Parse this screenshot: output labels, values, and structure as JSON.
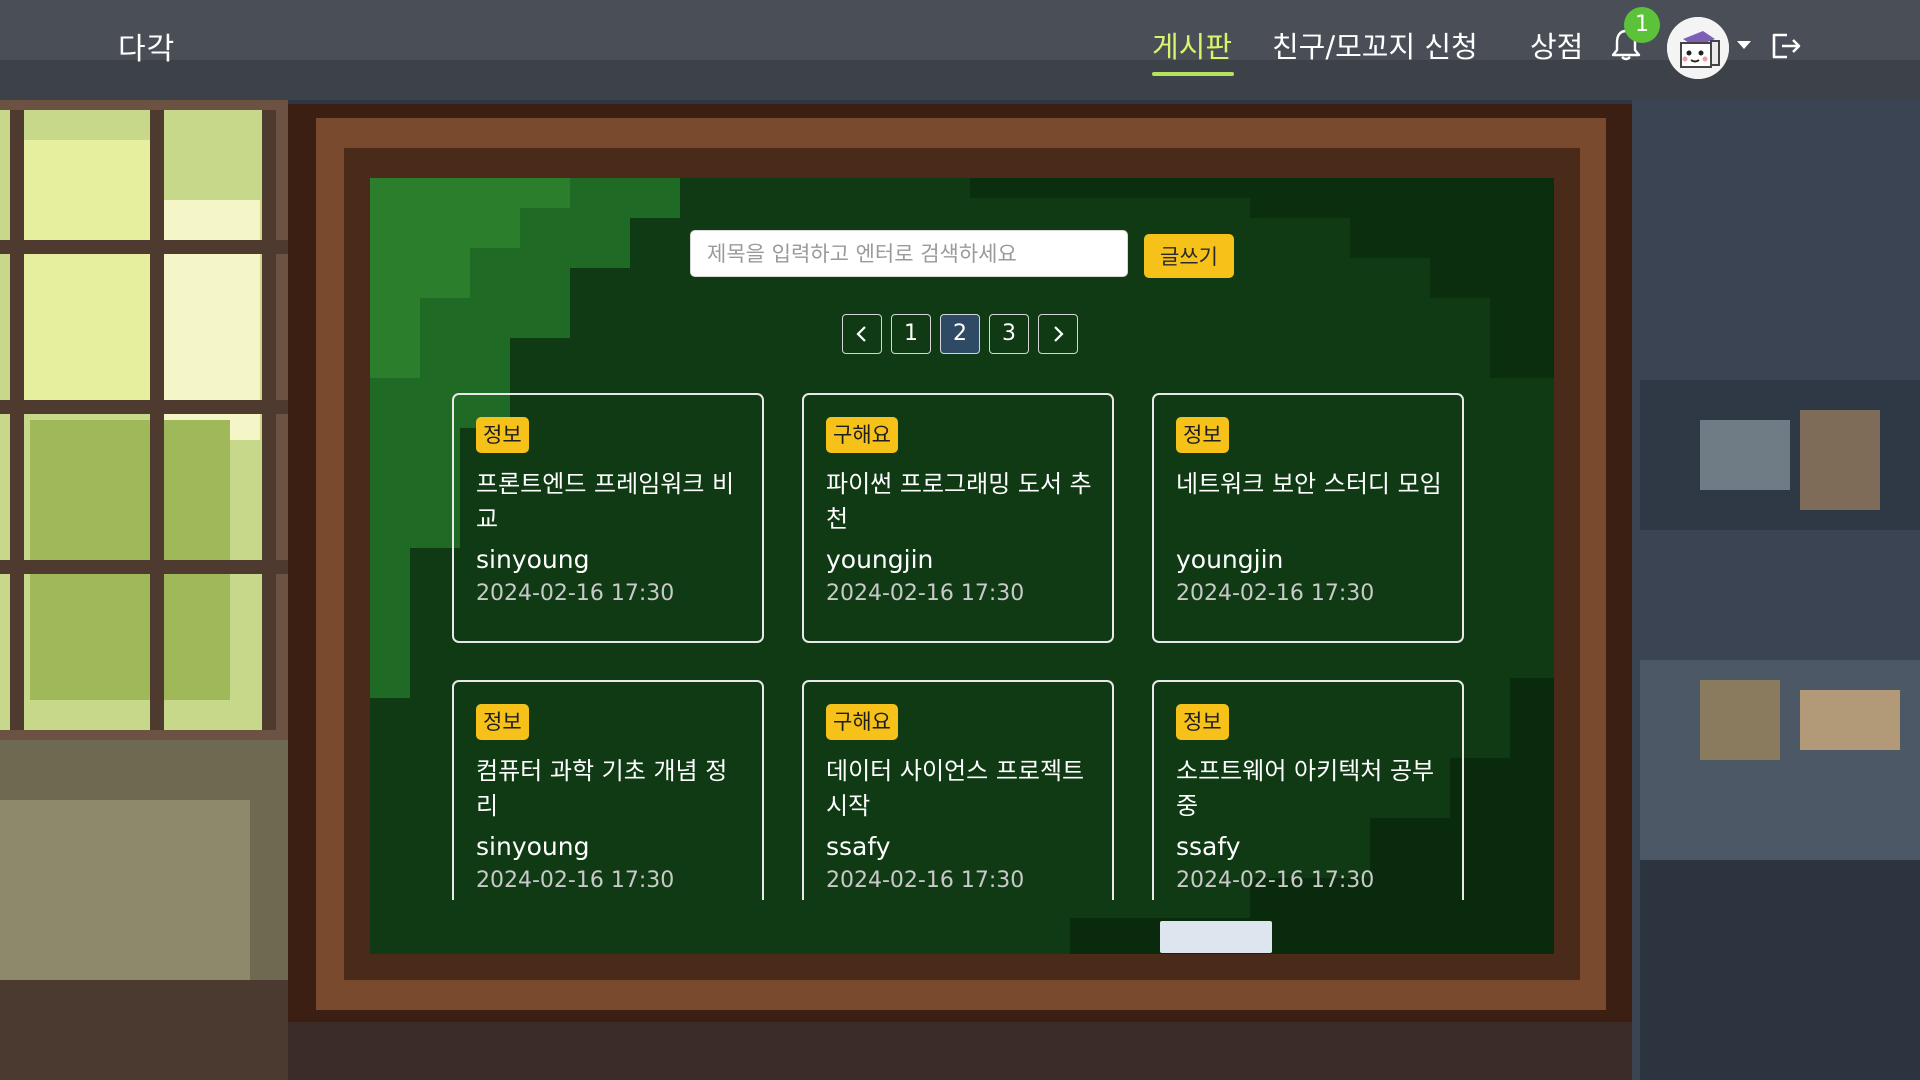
{
  "app": {
    "logo": "다각"
  },
  "nav": {
    "board": "게시판",
    "friends": "친구/모꼬지 신청",
    "shop": "상점",
    "notification_count": "1"
  },
  "board": {
    "search_placeholder": "제목을 입력하고 엔터로 검색하세요",
    "write_button": "글쓰기",
    "pagination": {
      "pages": [
        "1",
        "2",
        "3"
      ],
      "current": "2"
    },
    "posts": [
      {
        "tag": "정보",
        "title": "프론트엔드 프레임워크 비교",
        "author": "sinyoung",
        "date": "2024-02-16 17:30"
      },
      {
        "tag": "구해요",
        "title": "파이썬 프로그래밍 도서 추천",
        "author": "youngjin",
        "date": "2024-02-16 17:30"
      },
      {
        "tag": "정보",
        "title": "네트워크 보안 스터디 모임",
        "author": "youngjin",
        "date": "2024-02-16 17:30"
      },
      {
        "tag": "정보",
        "title": "컴퓨터 과학 기초 개념 정리",
        "author": "sinyoung",
        "date": "2024-02-16 17:30"
      },
      {
        "tag": "구해요",
        "title": "데이터 사이언스 프로젝트 시작",
        "author": "ssafy",
        "date": "2024-02-16 17:30"
      },
      {
        "tag": "정보",
        "title": "소프트웨어 아키텍처 공부 중",
        "author": "ssafy",
        "date": "2024-02-16 17:30"
      }
    ]
  },
  "colors": {
    "chalkboard": "#0f3a14",
    "tag": "#f6c21a",
    "active_nav": "#d8f56a",
    "badge": "#5cc23a"
  }
}
